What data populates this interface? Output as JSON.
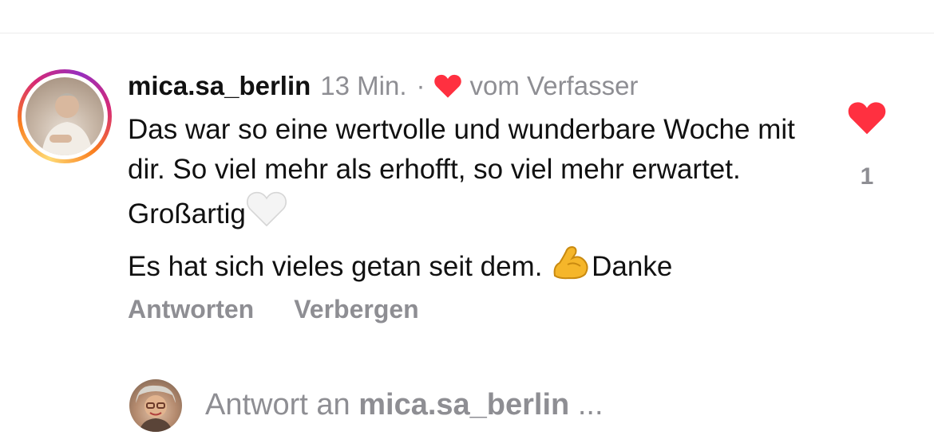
{
  "comment": {
    "username": "mica.sa_berlin",
    "time": "13 Min.",
    "separator": "·",
    "author_liked": "vom Verfasser",
    "text_line1": "Das war so eine wertvolle und wunderbare Woche mit dir. So viel mehr als erhofft, so viel mehr erwartet. Großartig",
    "text_line2_start": "Es hat sich vieles getan seit dem. ",
    "text_line2_end": "Danke",
    "like_count": "1"
  },
  "actions": {
    "reply": "Antworten",
    "hide": "Verbergen"
  },
  "reply_box": {
    "prefix": "Antwort an ",
    "target": "mica.sa_berlin",
    "suffix": " ..."
  },
  "icons": {
    "heart_color": "#ff3040",
    "white_heart": "white-heart-emoji",
    "flexed_biceps": "flexed-biceps-emoji",
    "like_heart": "heart-icon"
  }
}
